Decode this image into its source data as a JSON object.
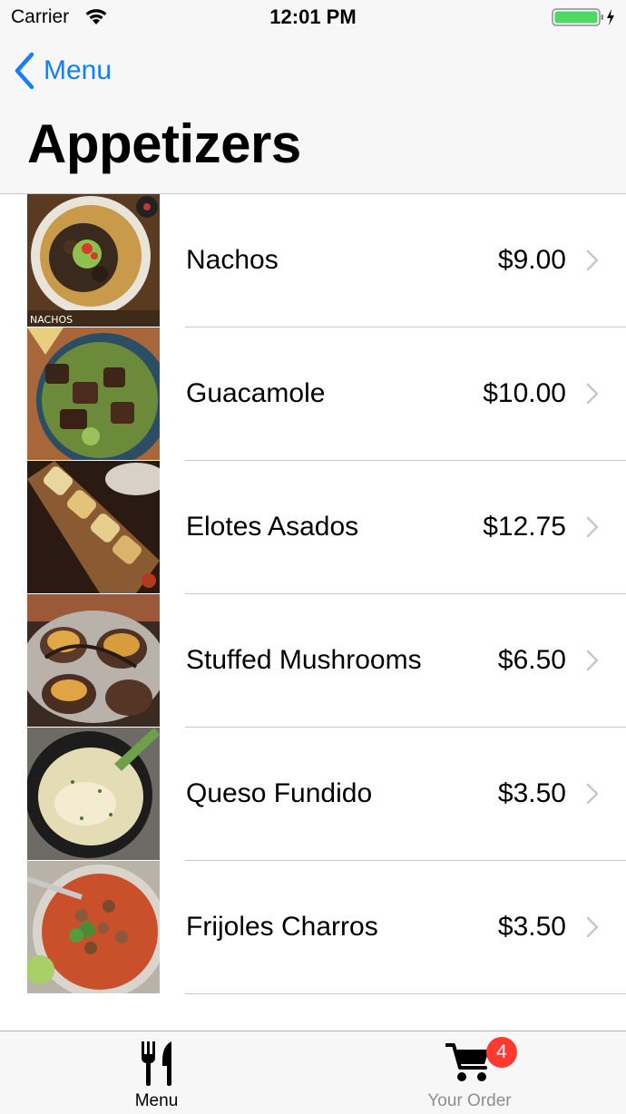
{
  "status_bar": {
    "carrier": "Carrier",
    "time": "12:01 PM",
    "wifi_icon": "wifi-icon",
    "battery_icon": "battery-charging-icon",
    "battery_color": "#4cd964"
  },
  "nav": {
    "back_label": "Menu",
    "back_icon": "chevron-left-icon",
    "title": "Appetizers",
    "accent_color": "#147efb"
  },
  "items": [
    {
      "name": "Nachos",
      "price": "$9.00",
      "thumb_caption": "NACHOS"
    },
    {
      "name": "Guacamole",
      "price": "$10.00"
    },
    {
      "name": "Elotes Asados",
      "price": "$12.75"
    },
    {
      "name": "Stuffed Mushrooms",
      "price": "$6.50"
    },
    {
      "name": "Queso Fundido",
      "price": "$3.50"
    },
    {
      "name": "Frijoles Charros",
      "price": "$3.50"
    }
  ],
  "tab_bar": {
    "tabs": [
      {
        "label": "Menu",
        "icon": "fork-knife-icon",
        "selected": true
      },
      {
        "label": "Your Order",
        "icon": "cart-icon",
        "selected": false,
        "badge": "4"
      }
    ],
    "badge_color": "#ff3b30"
  }
}
